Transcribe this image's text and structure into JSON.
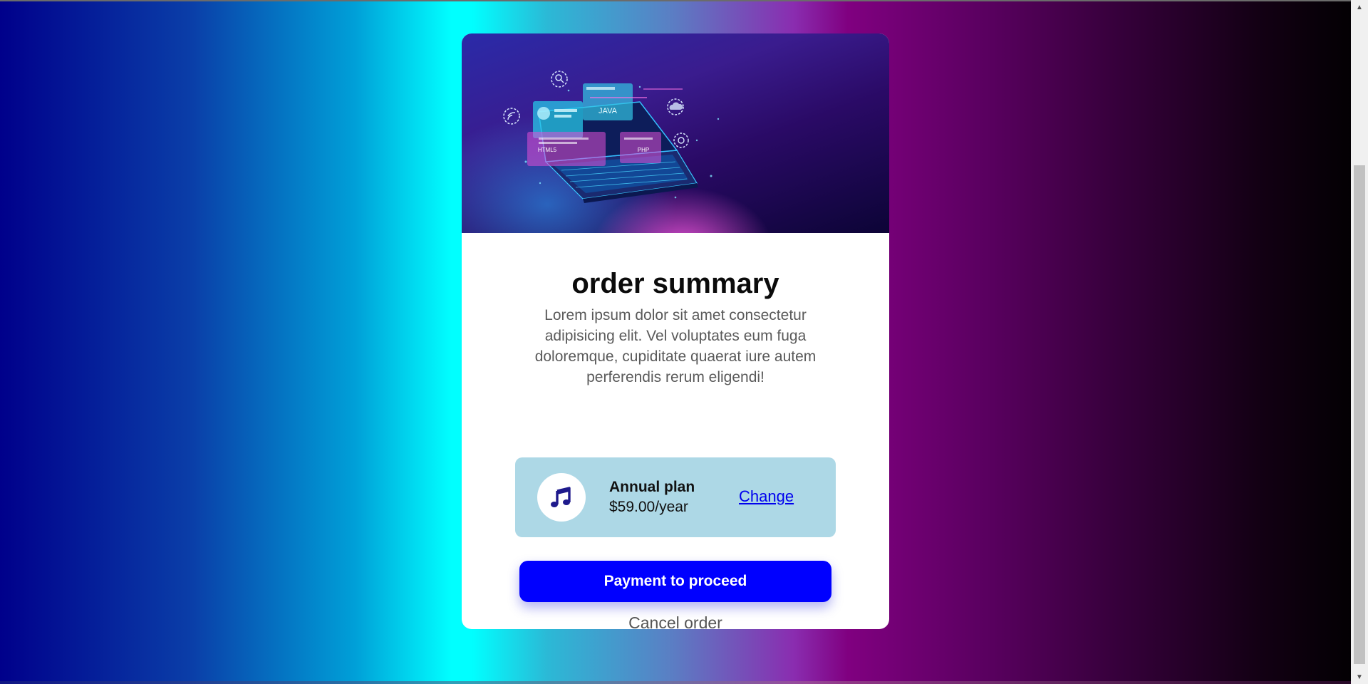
{
  "summary": {
    "title": "order summary",
    "description": "Lorem ipsum dolor sit amet consectetur adipisicing elit. Vel voluptates eum fuga doloremque, cupiditate quaerat iure autem perferendis rerum eligendi!"
  },
  "hero": {
    "label_java": "JAVA",
    "label_html": "HTML5",
    "label_php": "PHP"
  },
  "plan": {
    "icon": "music-note-icon",
    "name": "Annual plan",
    "price": "$59.00/year",
    "change_label": "Change"
  },
  "actions": {
    "pay_label": "Payment to proceed",
    "cancel_label": "Cancel order"
  },
  "colors": {
    "primary_button": "#0000ff",
    "plan_background": "#add8e6",
    "link": "#0000ee",
    "icon": "#1e1a8c"
  }
}
